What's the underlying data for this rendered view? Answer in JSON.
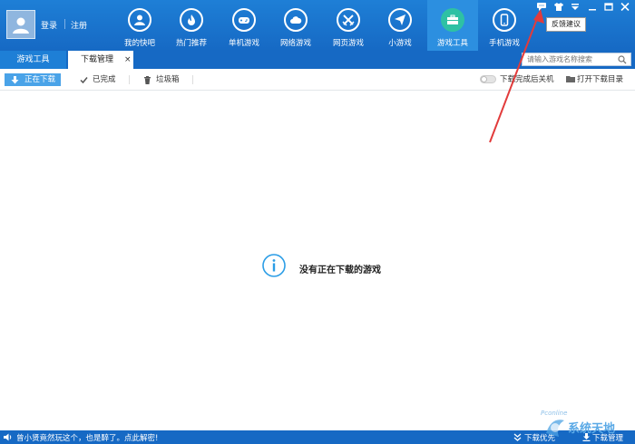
{
  "header": {
    "login": "登录",
    "register": "注册",
    "nav": [
      {
        "label": "我的快吧",
        "icon": "user-icon"
      },
      {
        "label": "热门推荐",
        "icon": "flame-icon"
      },
      {
        "label": "单机游戏",
        "icon": "gamepad-icon"
      },
      {
        "label": "网络游戏",
        "icon": "cloud-icon"
      },
      {
        "label": "网页游戏",
        "icon": "crossed-swords-icon"
      },
      {
        "label": "小游戏",
        "icon": "paper-plane-icon"
      },
      {
        "label": "游戏工具",
        "icon": "toolbox-icon"
      },
      {
        "label": "手机游戏",
        "icon": "phone-icon"
      }
    ],
    "active_nav": "游戏工具",
    "tooltip": "反馈建议"
  },
  "tabs": {
    "games": "游戏工具",
    "downloads": "下载管理",
    "close": "×"
  },
  "search": {
    "placeholder": "请输入游戏名称搜索"
  },
  "toolbar": {
    "downloading": "正在下载",
    "completed": "已完成",
    "trash": "垃圾箱",
    "shutdown": "下载完成后关机",
    "open_dir": "打开下载目录"
  },
  "main": {
    "empty_message": "没有正在下载的游戏"
  },
  "status": {
    "message": "曾小贤竟然玩这个，也是醉了。点此解密!",
    "download_first": "下载优先",
    "download_manager": "下载管理"
  },
  "watermark": {
    "text": "系统天地",
    "small": "Pconline"
  },
  "colors": {
    "header": "#1e7fd6",
    "active_nav": "#2ec1a4",
    "accent": "#4aa3e8",
    "annotation": "#e23b3b"
  }
}
